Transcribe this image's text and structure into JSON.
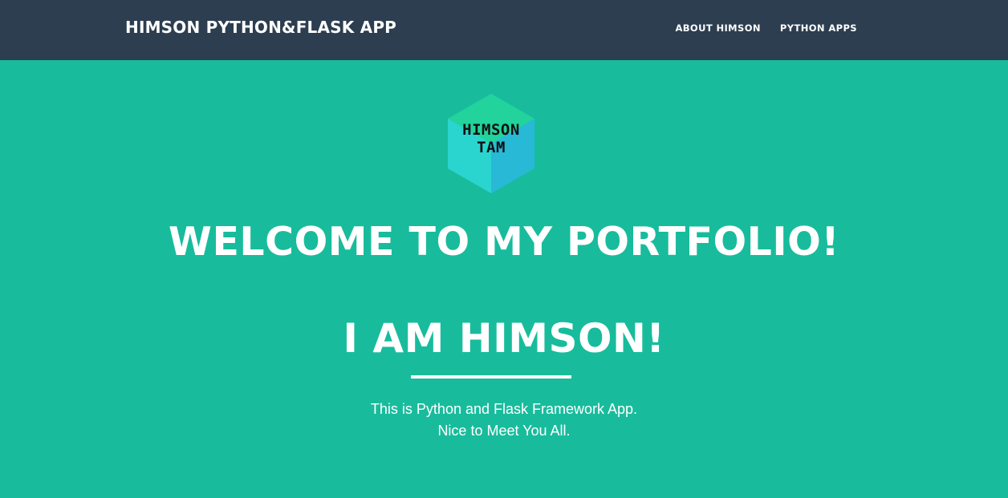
{
  "navbar": {
    "brand": "HIMSON PYTHON&FLASK APP",
    "links": [
      {
        "label": "ABOUT HIMSON"
      },
      {
        "label": "PYTHON APPS"
      }
    ]
  },
  "masthead": {
    "logo": {
      "line1": "HIMSON",
      "line2": "TAM"
    },
    "heading": "WELCOME TO MY PORTFOLIO!",
    "subheading": "I AM HIMSON!",
    "tagline_line1": "This is Python and Flask Framework App.",
    "tagline_line2": "Nice to Meet You All."
  },
  "colors": {
    "navbar_bg": "#2c3e50",
    "masthead_bg": "#18bc9c",
    "text": "#ffffff"
  }
}
